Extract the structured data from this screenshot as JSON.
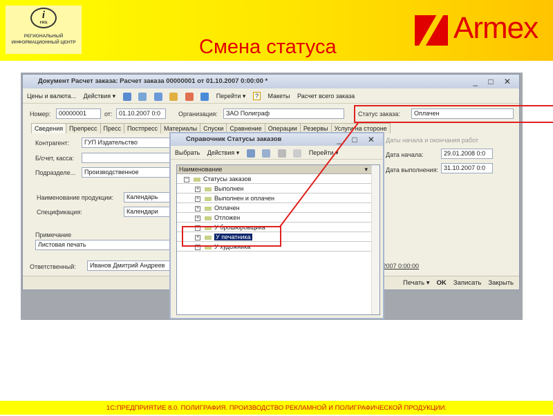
{
  "slide": {
    "title": "Смена статуса",
    "footer": "1С:ПРЕДПРИЯТИЕ 8.0. ПОЛИГРАФИЯ. ПРОИЗВОДСТВО РЕКЛАМНОЙ И ПОЛИГРАФИЧЕСКОЙ ПРОДУКЦИИ.",
    "logo_left": {
      "symbol": "i",
      "abbr": "РИЦ",
      "text": "РЕГИОНАЛЬНЫЙ ИНФОРМАЦИОННЫЙ ЦЕНТР"
    },
    "logo_right": "Armex"
  },
  "colors": {
    "accent": "#e00000",
    "yellow": "#ffff00",
    "selection": "#0a246a"
  },
  "doc": {
    "title": "Документ Расчет заказа: Расчет заказа 00000001 от 01.10.2007 0:00:00 *",
    "toolbar": {
      "prices": "Цены и валюта...",
      "actions": "Действия ▾",
      "goto": "Перейти ▾",
      "help": "?",
      "layouts": "Макеты",
      "calc_all": "Расчет всего заказа"
    },
    "number_label": "Номер:",
    "number": "00000001",
    "from_label": "от:",
    "date": "01.10.2007 0:0",
    "org_label": "Организация:",
    "org": "ЗАО Полиграф",
    "status_label": "Статус заказа:",
    "status": "Оплачен",
    "tabs": [
      "Сведения",
      "Препресс",
      "Пресс",
      "Постпресс",
      "Материалы",
      "Спуски",
      "Сравнение",
      "Операции",
      "Резервы",
      "Услуги на стороне"
    ],
    "contractor_label": "Контрагент:",
    "contractor": "ГУП Издательство",
    "account_label": "Б/счет, касса:",
    "account": "",
    "dept_label": "Подразделе...",
    "dept": "Производственное",
    "product_label": "Наименование продукции:",
    "product": "Календарь",
    "spec_label": "Спецификация:",
    "spec": "Календари",
    "note_label": "Примечание",
    "note": "Листовая печать",
    "dates_group": "Даты начала и окончания работ",
    "start_label": "Дата начала:",
    "start": "29.01.2008 0:0",
    "end_label": "Дата выполнения:",
    "end": "31.10.2007 0:0",
    "responsible_label": "Ответственный:",
    "responsible": "Иванов Дмитрий Андреев",
    "link": ".2007 0:00:00",
    "bottom": {
      "print": "Печать ▾",
      "ok": "OK",
      "save": "Записать",
      "close": "Закрыть"
    }
  },
  "dialog": {
    "title": "Справочник Статусы заказов",
    "toolbar": {
      "select": "Выбрать",
      "actions": "Действия ▾",
      "goto": "Перейти ▾"
    },
    "column": "Наименование",
    "root": "Статусы заказов",
    "items": [
      "Выполнен",
      "Выполнен и оплачен",
      "Оплачен",
      "Отложен",
      "У брошюровщика",
      "У печатника",
      "У художника"
    ],
    "selected": "У печатника"
  }
}
